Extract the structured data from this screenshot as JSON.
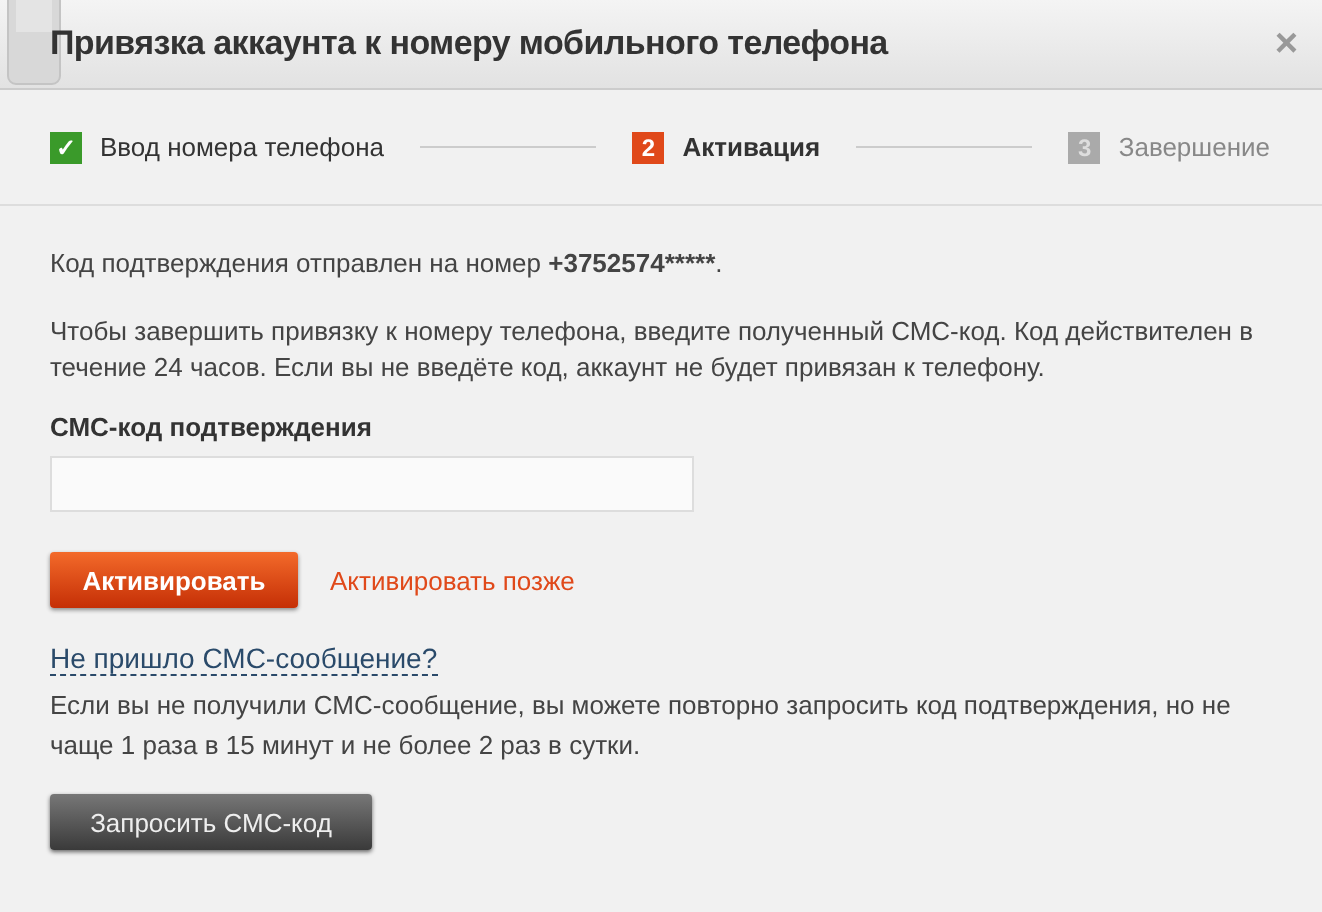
{
  "window": {
    "title": "Привязка аккаунта к номеру мобильного телефона",
    "close": "×"
  },
  "steps": [
    {
      "marker": "✓",
      "label": "Ввод номера телефона",
      "kind": "done"
    },
    {
      "marker": "2",
      "label": "Активация",
      "kind": "active"
    },
    {
      "marker": "3",
      "label": "Завершение",
      "kind": "pending"
    }
  ],
  "message": {
    "text": "Код подтверждения отправлен на номер",
    "number": "+3752574*****",
    "end": "."
  },
  "instructions": "Чтобы завершить привязку к номеру телефона, введите полученный СМС-код. Код действителен в течение 24 часов. Если вы не введёте код, аккаунт не будет привязан к телефону.",
  "code_field": {
    "label": "СМС-код подтверждения"
  },
  "activate_button": "Активировать",
  "later_link": "Активировать позже",
  "no_sms_link": "Не пришло СМС-сообщение?",
  "resend_note": "Если вы не получили СМС-сообщение, вы можете повторно запросить код подтверждения, но не чаще 1 раза в 15 минут и не более 2 раз в сутки.",
  "resend_button": "Запросить СМС-код"
}
